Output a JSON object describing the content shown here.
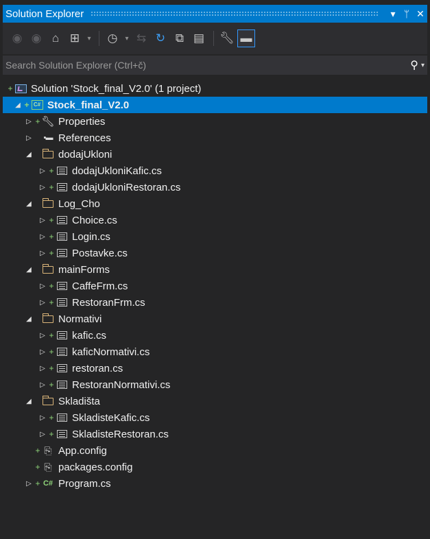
{
  "window": {
    "title": "Solution Explorer",
    "dropdown_icon": "▾",
    "pin_icon": "ᛘ",
    "close_icon": "✕"
  },
  "toolbar": {
    "buttons": [
      "back",
      "forward",
      "home",
      "switch-views",
      "dropdown",
      "pending-changes-filter",
      "dropdown",
      "sync-with-active-document",
      "refresh",
      "collapse-all",
      "show-all-files",
      "properties",
      "preview-selected-items"
    ]
  },
  "search": {
    "placeholder": "Search Solution Explorer (Ctrl+č)"
  },
  "tree": {
    "solution": "Solution 'Stock_final_V2.0' (1 project)",
    "project": "Stock_final_V2.0",
    "properties": "Properties",
    "references": "References",
    "folders": {
      "dodajUkloni": {
        "label": "dodajUkloni",
        "files": [
          "dodajUkloniKafic.cs",
          "dodajUkloniRestoran.cs"
        ]
      },
      "logCho": {
        "label": "Log_Cho",
        "files": [
          "Choice.cs",
          "Login.cs",
          "Postavke.cs"
        ]
      },
      "mainForms": {
        "label": "mainForms",
        "files": [
          "CaffeFrm.cs",
          "RestoranFrm.cs"
        ]
      },
      "normativi": {
        "label": "Normativi",
        "files": [
          "kafic.cs",
          "kaficNormativi.cs",
          "restoran.cs",
          "RestoranNormativi.cs"
        ]
      },
      "skladista": {
        "label": "Skladišta",
        "files": [
          "SkladisteKafic.cs",
          "SkladisteRestoran.cs"
        ]
      }
    },
    "app_config": "App.config",
    "packages_config": "packages.config",
    "program": "Program.cs"
  },
  "colors": {
    "accent": "#007acc",
    "background": "#252526",
    "folder": "#dcb67a",
    "added": "#8fd47a"
  }
}
